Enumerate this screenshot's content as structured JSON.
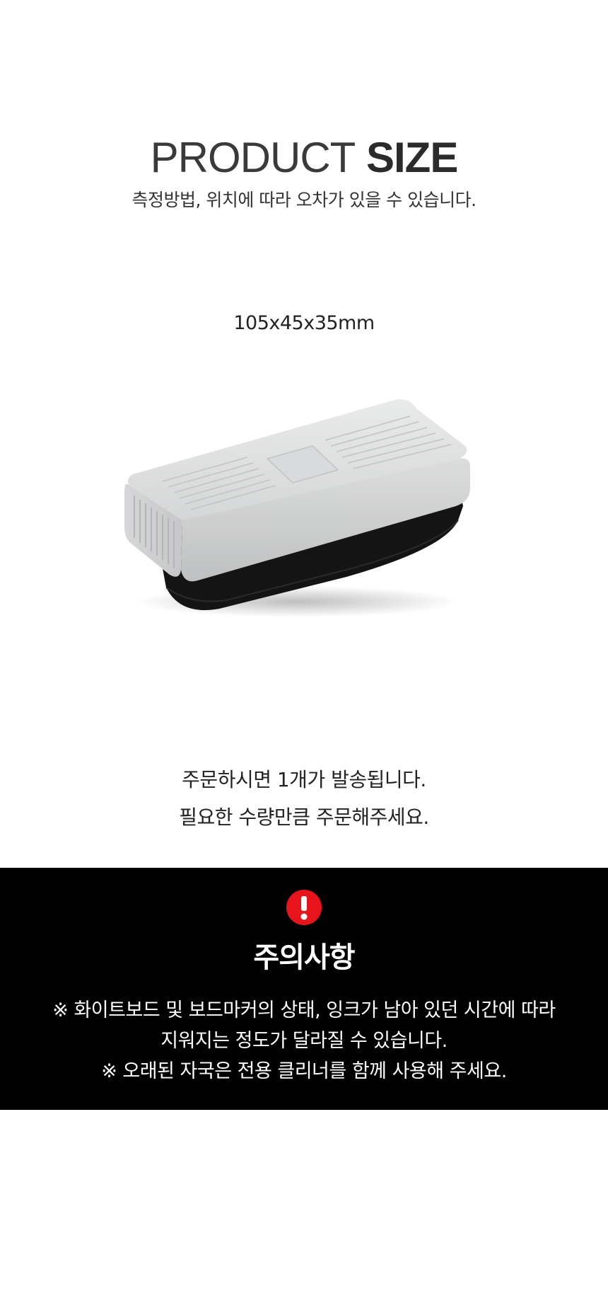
{
  "header": {
    "title_light": "PRODUCT",
    "title_bold": "SIZE",
    "subtitle": "측정방법, 위치에 따라 오차가 있을 수 있습니다."
  },
  "product": {
    "dimensions": "105x45x35mm",
    "image_name": "whiteboard-eraser"
  },
  "order_note": {
    "line1": "주문하시면 1개가 발송됩니다.",
    "line2": "필요한 수량만큼 주문해주세요."
  },
  "caution": {
    "icon": "exclamation-icon",
    "icon_color": "#e8141c",
    "title": "주의사항",
    "line1": "※ 화이트보드 및 보드마커의 상태, 잉크가 남아 있던 시간에 따라",
    "line2": "지워지는 정도가 달라질 수 있습니다.",
    "line3": "※ 오래된 자국은 전용 클리너를 함께 사용해 주세요."
  },
  "colors": {
    "background": "#ffffff",
    "caution_background": "#000000",
    "text": "#222222"
  }
}
